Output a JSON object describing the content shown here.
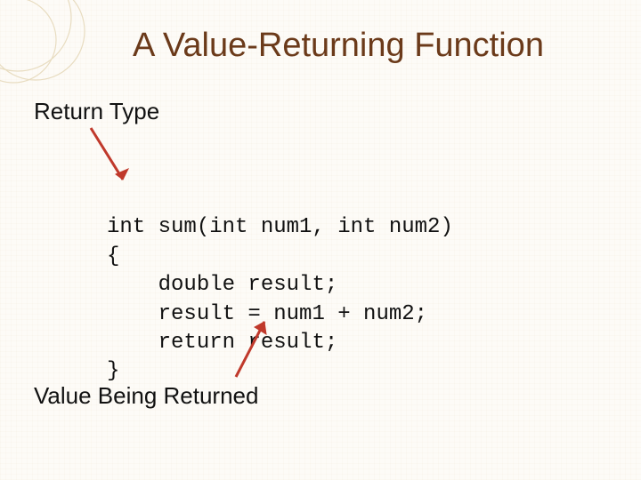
{
  "title": "A Value-Returning Function",
  "label_return_type": "Return Type",
  "label_value_returned": "Value Being Returned",
  "code": {
    "l1": "int sum(int num1, int num2)",
    "l2": "{",
    "l3": "    double result;",
    "l4": "    result = num1 + num2;",
    "l5": "    return result;",
    "l6": "}"
  }
}
